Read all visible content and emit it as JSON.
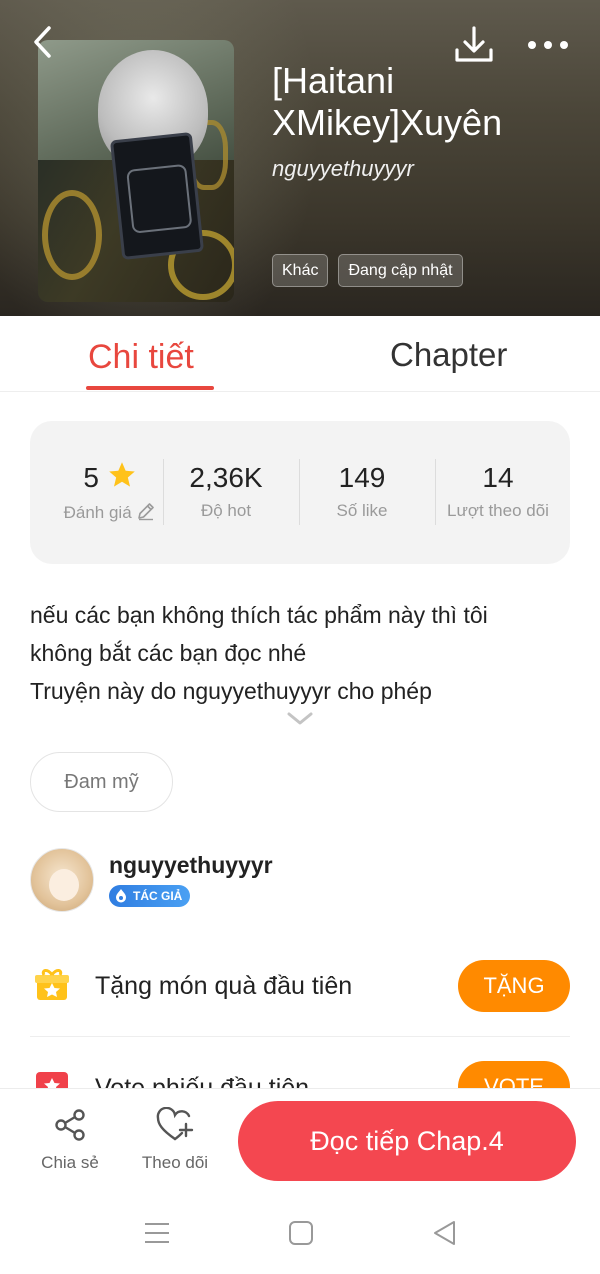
{
  "header": {
    "title": "[Haitani XMikey]Xuyên",
    "author": "nguyyethuyyyr",
    "tags": [
      "Khác",
      "Đang cập nhật"
    ]
  },
  "tabs": [
    {
      "label": "Chi tiết",
      "active": true
    },
    {
      "label": "Chapter",
      "active": false
    }
  ],
  "stats": [
    {
      "value": "5",
      "label": "Đánh giá"
    },
    {
      "value": "2,36K",
      "label": "Độ hot"
    },
    {
      "value": "149",
      "label": "Số like"
    },
    {
      "value": "14",
      "label": "Lượt theo dõi"
    }
  ],
  "description": {
    "line1": "nếu các bạn không thích tác phẩm này thì tôi",
    "line2": "không bắt các bạn đọc nhé",
    "line3": "Truyện này do nguyyethuyyyr cho phép"
  },
  "genre": "Đam mỹ",
  "author_card": {
    "name": "nguyyethuyyyr",
    "badge": "TÁC GIẢ"
  },
  "gift_rows": [
    {
      "text": "Tặng món quà đầu tiên",
      "button": "TẶNG",
      "icon": "gift-icon"
    },
    {
      "text": "Vote phiếu đầu tiên",
      "button": "VOTE",
      "icon": "ticket-icon"
    }
  ],
  "bottom_bar": {
    "share": "Chia sẻ",
    "follow": "Theo dõi",
    "read": "Đọc tiếp Chap.4"
  },
  "colors": {
    "accent": "#e8473e",
    "orange": "#ff8a00",
    "read_button": "#f44750"
  }
}
